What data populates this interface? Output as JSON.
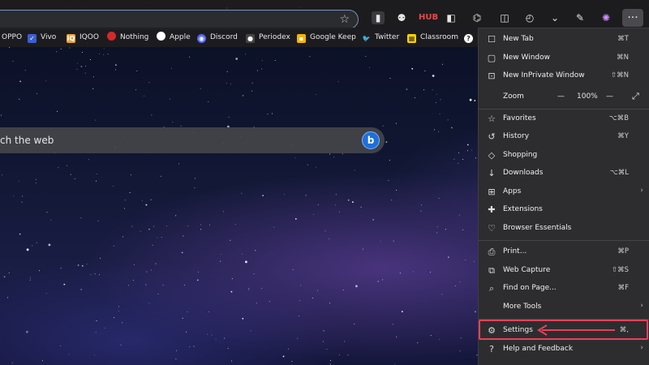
{
  "toolbar": {
    "star_icon": "☆",
    "icons": [
      {
        "name": "extension-reader-icon",
        "glyph": "▮"
      },
      {
        "name": "extension-bot-icon",
        "glyph": "⚉"
      },
      {
        "name": "extension-hub-icon",
        "glyph": "HUB"
      },
      {
        "name": "extension-window-icon",
        "glyph": "◧"
      },
      {
        "name": "extension-puzzle-icon",
        "glyph": "⌬"
      },
      {
        "name": "split-screen-icon",
        "glyph": "◫"
      },
      {
        "name": "history-icon",
        "glyph": "◴"
      },
      {
        "name": "downloads-icon",
        "glyph": "⌄"
      },
      {
        "name": "copilot-icon",
        "glyph": "✎"
      },
      {
        "name": "profile-icon",
        "glyph": "✺"
      },
      {
        "name": "more-menu-icon",
        "glyph": "···"
      }
    ]
  },
  "bookmarks": [
    {
      "label": "OPPO",
      "icon": "",
      "color": "#2f6fdb"
    },
    {
      "label": "Vivo",
      "icon": "✓",
      "color": "#3a5fd1"
    },
    {
      "label": "IQOO",
      "icon": "iQ",
      "color": "#e8a23a"
    },
    {
      "label": "Nothing",
      "icon": "",
      "color": "#d62828"
    },
    {
      "label": "Apple",
      "icon": "",
      "color": "#ffffff"
    },
    {
      "label": "Discord",
      "icon": "◉",
      "color": "#5865f2"
    },
    {
      "label": "Periodex",
      "icon": "●",
      "color": "#444"
    },
    {
      "label": "Google Keep",
      "icon": "▪",
      "color": "#f4b400"
    },
    {
      "label": "Twitter",
      "icon": "🐦",
      "color": "#1da1f2"
    },
    {
      "label": "Classroom",
      "icon": "▦",
      "color": "#ffd400"
    }
  ],
  "search": {
    "placeholder": "ch the web",
    "bing_icon": "b"
  },
  "menu": {
    "items": [
      {
        "name": "new-tab",
        "icon": "☐",
        "label": "New Tab",
        "shortcut": "⌘T"
      },
      {
        "name": "new-window",
        "icon": "▢",
        "label": "New Window",
        "shortcut": "⌘N"
      },
      {
        "name": "new-inprivate-window",
        "icon": "⊡",
        "label": "New InPrivate Window",
        "shortcut": "⇧⌘N"
      },
      {
        "name": "favorites",
        "icon": "☆",
        "label": "Favorites",
        "shortcut": "⌥⌘B"
      },
      {
        "name": "history",
        "icon": "↺",
        "label": "History",
        "shortcut": "⌘Y"
      },
      {
        "name": "shopping",
        "icon": "◇",
        "label": "Shopping",
        "shortcut": ""
      },
      {
        "name": "downloads",
        "icon": "↓",
        "label": "Downloads",
        "shortcut": "⌥⌘L"
      },
      {
        "name": "apps",
        "icon": "⊞",
        "label": "Apps",
        "shortcut": ""
      },
      {
        "name": "extensions",
        "icon": "✚",
        "label": "Extensions",
        "shortcut": ""
      },
      {
        "name": "browser-essentials",
        "icon": "♡",
        "label": "Browser Essentials",
        "shortcut": ""
      },
      {
        "name": "print",
        "icon": "⎙",
        "label": "Print...",
        "shortcut": "⌘P"
      },
      {
        "name": "web-capture",
        "icon": "⧉",
        "label": "Web Capture",
        "shortcut": "⇧⌘S"
      },
      {
        "name": "find-on-page",
        "icon": "⌕",
        "label": "Find on Page...",
        "shortcut": "⌘F"
      },
      {
        "name": "more-tools",
        "icon": "",
        "label": "More Tools",
        "shortcut": ""
      },
      {
        "name": "settings",
        "icon": "⚙",
        "label": "Settings",
        "shortcut": "⌘,"
      },
      {
        "name": "help-and-feedback",
        "icon": "?",
        "label": "Help and Feedback",
        "shortcut": ""
      }
    ],
    "zoom": {
      "label": "Zoom",
      "minus": "—",
      "value": "100%",
      "plus": "—",
      "expand": "⤢"
    },
    "arrow_glyph": "›"
  },
  "colors": {
    "highlight": "#e8415a",
    "menu_bg": "#2d2d30"
  }
}
